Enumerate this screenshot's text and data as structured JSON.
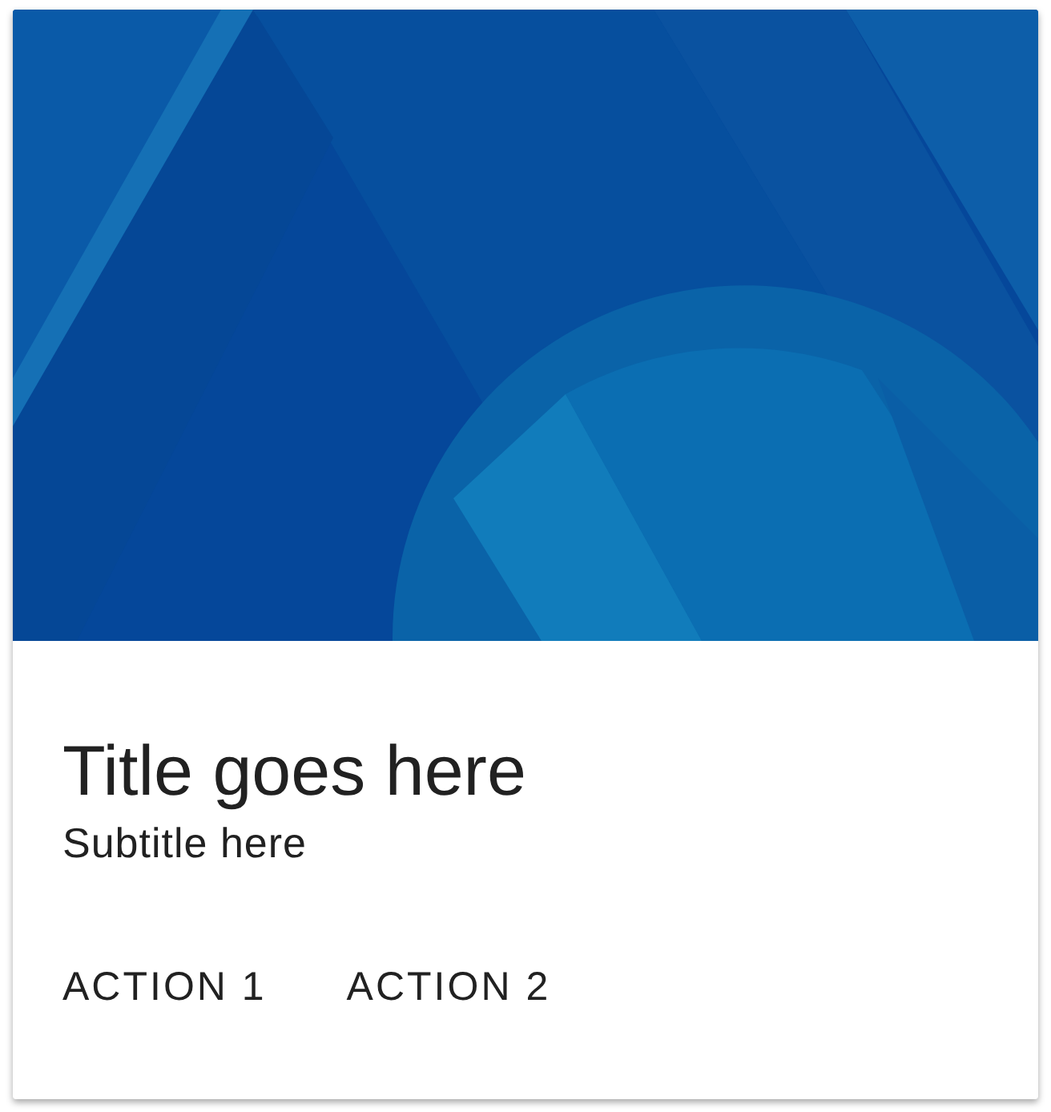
{
  "card": {
    "title": "Title goes here",
    "subtitle": "Subtitle here",
    "actions": [
      "ACTION 1",
      "ACTION 2"
    ]
  }
}
